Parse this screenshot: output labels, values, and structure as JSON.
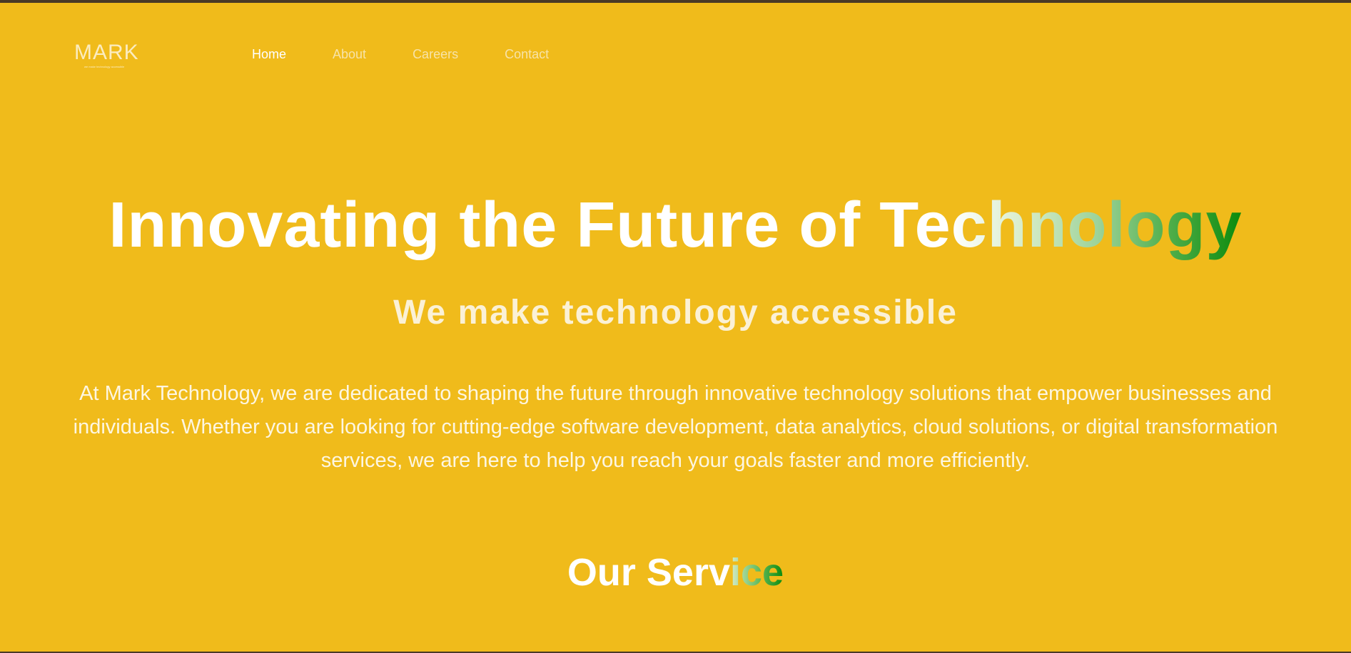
{
  "brand": {
    "logo_text": "MARK",
    "logo_tagline": "we make technology accessible"
  },
  "nav": {
    "items": [
      {
        "label": "Home",
        "active": true
      },
      {
        "label": "About",
        "active": false
      },
      {
        "label": "Careers",
        "active": false
      },
      {
        "label": "Contact",
        "active": false
      }
    ]
  },
  "hero": {
    "title_plain": "Innovating the Future of Te",
    "title_gradient": "chnology",
    "subtitle": "We make technology accessible",
    "intro": "At Mark Technology, we are dedicated to shaping the future through innovative technology solutions that empower businesses and individuals. Whether you are looking for cutting-edge software development, data analytics, cloud solutions, or digital transformation services, we are here to help you reach your goals faster and more efficiently."
  },
  "services": {
    "title_plain": "Our Serv",
    "title_gradient": "ice"
  },
  "colors": {
    "background": "#f0bb1b",
    "text": "#ffffff",
    "gradient_end": "#0b8a0b",
    "border": "#4a3a26"
  }
}
